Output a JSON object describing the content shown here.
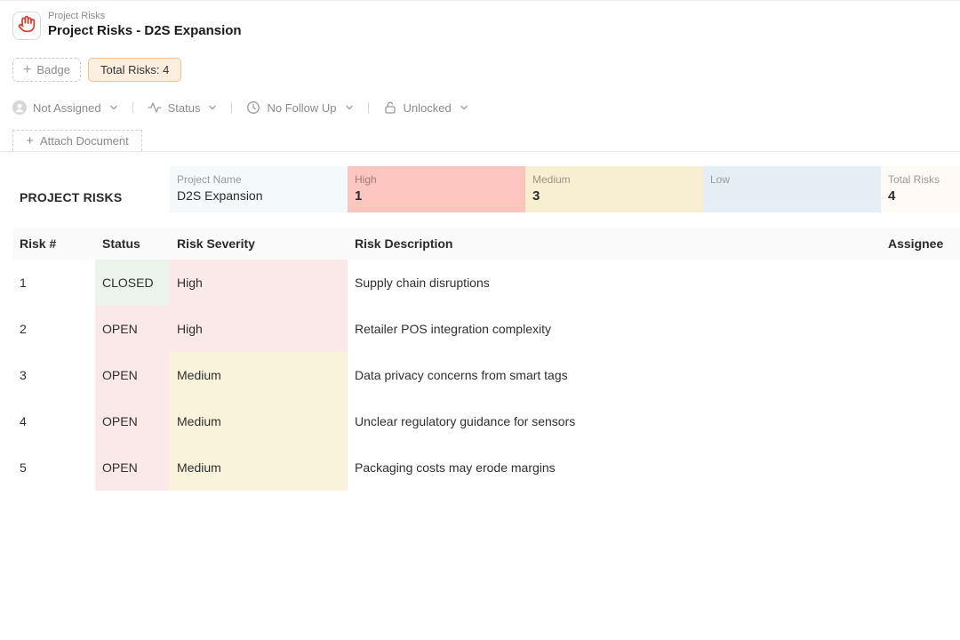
{
  "header": {
    "breadcrumb": "Project Risks",
    "title": "Project Risks - D2S Expansion",
    "icon": "hand-icon",
    "accent_color": "#d9382b"
  },
  "badges": {
    "add_label": "Badge",
    "total_label": "Total Risks: 4"
  },
  "toolbar": {
    "assignee": "Not Assigned",
    "status": "Status",
    "follow_up": "No Follow Up",
    "lock": "Unlocked"
  },
  "attach": {
    "label": "Attach Document"
  },
  "summary": {
    "title": "PROJECT RISKS",
    "project_name_label": "Project Name",
    "project_name_value": "D2S Expansion",
    "high_label": "High",
    "high_value": "1",
    "medium_label": "Medium",
    "medium_value": "3",
    "low_label": "Low",
    "low_value": "",
    "total_label": "Total Risks",
    "total_value": "4",
    "colors": {
      "high": "#fcc5bf",
      "medium": "#f8efd3",
      "low": "#e5eef4"
    }
  },
  "table": {
    "columns": {
      "num": "Risk #",
      "status": "Status",
      "severity": "Risk Severity",
      "description": "Risk Description",
      "assignee": "Assignee"
    },
    "rows": [
      {
        "num": "1",
        "status": "CLOSED",
        "severity": "High",
        "description": "Supply chain disruptions"
      },
      {
        "num": "2",
        "status": "OPEN",
        "severity": "High",
        "description": "Retailer POS integration complexity"
      },
      {
        "num": "3",
        "status": "OPEN",
        "severity": "Medium",
        "description": "Data privacy concerns from smart tags"
      },
      {
        "num": "4",
        "status": "OPEN",
        "severity": "Medium",
        "description": "Unclear regulatory guidance for sensors"
      },
      {
        "num": "5",
        "status": "OPEN",
        "severity": "Medium",
        "description": "Packaging costs may erode margins"
      }
    ]
  }
}
